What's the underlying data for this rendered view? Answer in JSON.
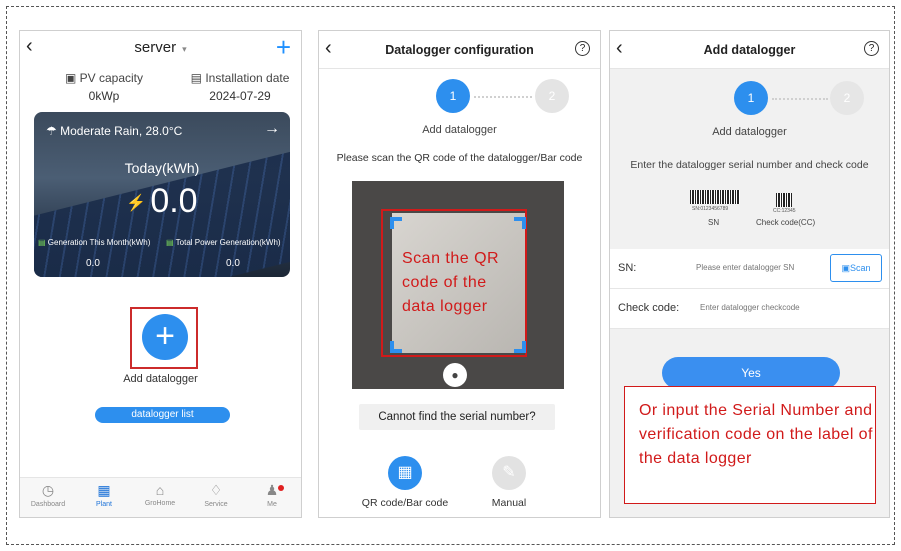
{
  "colors": {
    "accent": "#2d8fee",
    "annotation_red": "#d11a1a",
    "tab_active": "#1e73d8"
  },
  "phone1": {
    "title": "server",
    "stats": [
      {
        "icon": "pv-capacity-icon",
        "label": "PV capacity",
        "value": "0kWp"
      },
      {
        "icon": "calendar-icon",
        "label": "Installation date",
        "value": "2024-07-29"
      }
    ],
    "weather": "Moderate Rain,  28.0°C",
    "today_label": "Today(kWh)",
    "today_value": "0.0",
    "gen_month_label": "Generation This Month(kWh)",
    "gen_month_value": "0.0",
    "total_label": "Total Power Generation(kWh)",
    "total_value": "0.0",
    "add_label": "Add datalogger",
    "list_button": "datalogger list",
    "tabs": [
      {
        "label": "Dashboard",
        "icon": "dashboard-icon"
      },
      {
        "label": "Plant",
        "icon": "plant-icon"
      },
      {
        "label": "GroHome",
        "icon": "home-icon"
      },
      {
        "label": "Service",
        "icon": "service-icon"
      },
      {
        "label": "Me",
        "icon": "person-icon"
      }
    ]
  },
  "phone2": {
    "title": "Datalogger configuration",
    "steps": [
      "1",
      "2"
    ],
    "step_label": "Add datalogger",
    "instruction": "Please scan the QR code of the datalogger/Bar code",
    "scan_annotation": "Scan the QR code of the data logger",
    "cannot_find": "Cannot find the serial number?",
    "modes": [
      {
        "label": "QR code/Bar code",
        "icon": "qr-code-icon"
      },
      {
        "label": "Manual",
        "icon": "pencil-icon"
      }
    ]
  },
  "phone3": {
    "title": "Add datalogger",
    "steps": [
      "1",
      "2"
    ],
    "step_label": "Add datalogger",
    "instruction": "Enter the datalogger serial number and check code",
    "sn_barcode_text": "SN:0123456789",
    "sn_caption": "SN",
    "cc_barcode_text": "CC:12345",
    "cc_caption": "Check code(CC)",
    "sn_label": "SN:",
    "sn_placeholder": "Please enter datalogger SN",
    "scan_button": "Scan",
    "check_label": "Check code:",
    "check_placeholder": "Enter datalogger checkcode",
    "yes_button": "Yes",
    "annotation": "Or input the Serial Number and verification code on the label of the data logger"
  }
}
